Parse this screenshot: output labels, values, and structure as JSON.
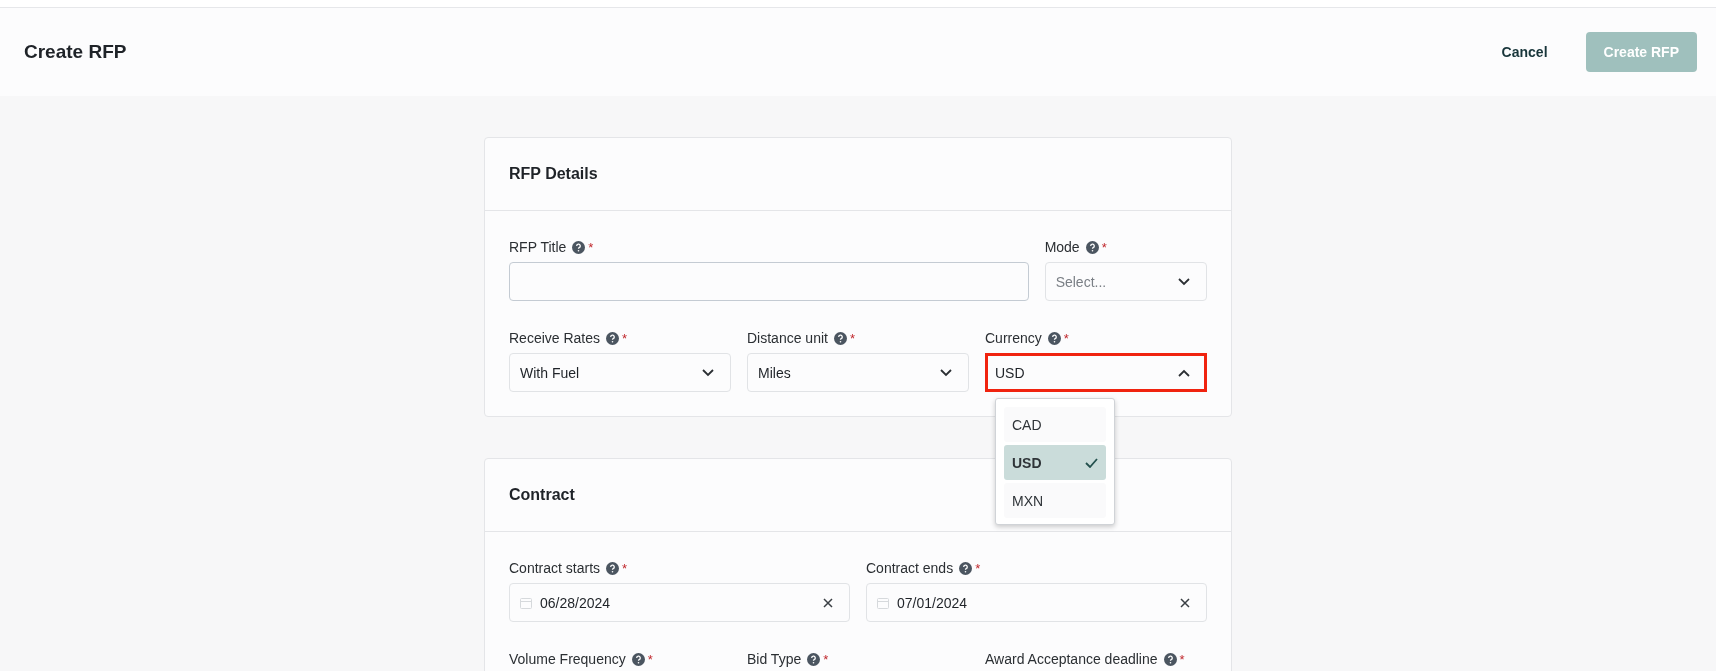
{
  "header": {
    "title": "Create RFP",
    "cancel": "Cancel",
    "submit": {
      "label": "Create RFP",
      "disabled": true
    }
  },
  "rfp_details": {
    "title": "RFP Details",
    "rows": [
      [
        {
          "kind": "text",
          "label": "RFP Title",
          "mark": "*"
        },
        {
          "kind": "select",
          "label": "Mode",
          "mark": "*",
          "placeholder": "Select...",
          "open": false
        }
      ],
      [
        {
          "kind": "select",
          "label": "Receive Rates",
          "mark": "*",
          "value": "With Fuel",
          "open": false
        },
        {
          "kind": "select",
          "label": "Distance unit",
          "mark": "*",
          "value": "Miles",
          "open": false
        },
        {
          "kind": "select",
          "label": "Currency",
          "mark": "*",
          "value": "USD",
          "open": true,
          "highlighted": true,
          "options": [
            {
              "label": "CAD",
              "selected": false
            },
            {
              "label": "USD",
              "selected": true
            },
            {
              "label": "MXN",
              "selected": false
            }
          ]
        }
      ]
    ]
  },
  "contract": {
    "title": "Contract",
    "rows": [
      [
        {
          "kind": "date",
          "label": "Contract starts",
          "mark": "*",
          "value": "06/28/2024"
        },
        {
          "kind": "date",
          "label": "Contract ends",
          "mark": "*",
          "value": "07/01/2024"
        }
      ],
      [
        {
          "kind": "label",
          "label": "Volume Frequency",
          "mark": "*"
        },
        {
          "kind": "label",
          "label": "Bid Type",
          "mark": "*"
        },
        {
          "kind": "label",
          "label": "Award Acceptance deadline",
          "mark": "*"
        }
      ]
    ]
  }
}
